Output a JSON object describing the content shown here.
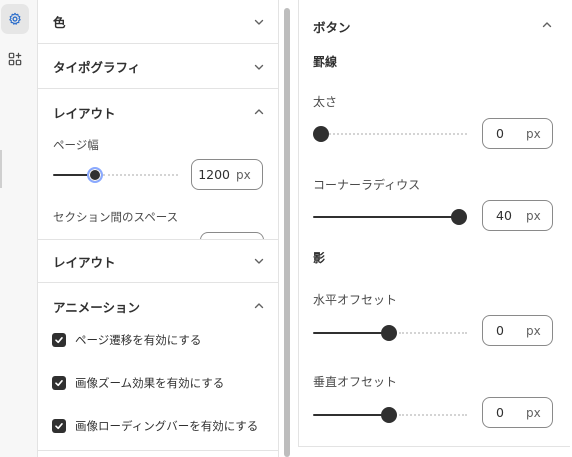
{
  "rail": {
    "items": [
      {
        "icon": "gear-icon",
        "active": true
      },
      {
        "icon": "apps-icon",
        "active": false
      }
    ]
  },
  "left": {
    "color_section": {
      "title": "色",
      "expanded": false
    },
    "typography_section": {
      "title": "タイポグラフィ",
      "expanded": false
    },
    "layout_section": {
      "title": "レイアウト",
      "expanded": true,
      "page_width": {
        "label": "ページ幅",
        "value": "1200",
        "unit": "px",
        "level": 0.36
      },
      "section_spacing": {
        "label": "セクション間のスペース"
      }
    },
    "layout_section_2": {
      "title": "レイアウト",
      "expanded": false
    },
    "animation_section": {
      "title": "アニメーション",
      "expanded": true,
      "checkboxes": [
        {
          "label": "ページ遷移を有効にする",
          "checked": true
        },
        {
          "label": "画像ズーム効果を有効にする",
          "checked": true
        },
        {
          "label": "画像ローディングバーを有効にする",
          "checked": true
        }
      ]
    }
  },
  "right": {
    "section_title": "ボタン",
    "expanded": true,
    "border_group": {
      "title": "罫線",
      "thickness": {
        "label": "太さ",
        "value": "0",
        "unit": "px",
        "level": 0.0
      },
      "corner_radius": {
        "label": "コーナーラディウス",
        "value": "40",
        "unit": "px",
        "level": 1.0
      }
    },
    "shadow_group": {
      "title": "影",
      "horizontal_offset": {
        "label": "水平オフセット",
        "value": "0",
        "unit": "px",
        "level": 0.5
      },
      "vertical_offset": {
        "label": "垂直オフセット",
        "value": "0",
        "unit": "px",
        "level": 0.5
      }
    }
  },
  "colors": {
    "accent": "#303030",
    "border": "#e3e3e3",
    "focus_ring": "#8aa9ff"
  }
}
